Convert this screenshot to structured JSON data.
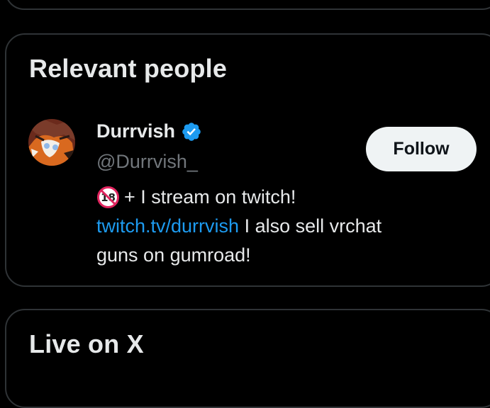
{
  "sections": {
    "relevant_people": {
      "title": "Relevant people"
    },
    "live": {
      "title": "Live on X"
    }
  },
  "person": {
    "name": "Durrvish",
    "handle": "@Durrvish_",
    "follow_label": "Follow",
    "verified": true,
    "bio": {
      "line1_text": "+ I stream on twitch!",
      "link_text": "twitch.tv/durrvish",
      "line2_text": " I also sell vrchat",
      "line3_text": "guns on gumroad!"
    }
  },
  "colors": {
    "background": "#000000",
    "border": "#2f3336",
    "text_primary": "#e7e9ea",
    "text_secondary": "#71767b",
    "link": "#1d9bf0",
    "verified_badge": "#1d9bf0",
    "follow_bg": "#eff3f4"
  },
  "icons": {
    "verified": "verified-badge-icon",
    "no_under_18": "no-one-under-eighteen-emoji"
  }
}
